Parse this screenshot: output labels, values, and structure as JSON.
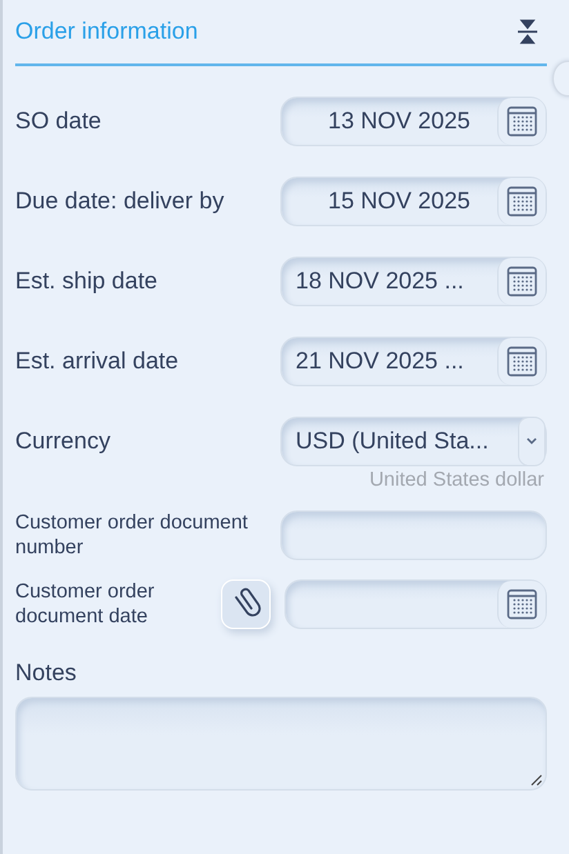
{
  "section": {
    "title": "Order information",
    "rows": [
      {
        "kind": "date",
        "label": "SO date",
        "value": "13 NOV 2025"
      },
      {
        "kind": "date",
        "label": "Due date: deliver by",
        "value": "15 NOV 2025"
      },
      {
        "kind": "date",
        "label": "Est. ship date",
        "value": "18 NOV 2025 ..."
      },
      {
        "kind": "date",
        "label": "Est. arrival date",
        "value": "21 NOV 2025 ..."
      },
      {
        "kind": "select",
        "label": "Currency",
        "value": "USD (United Sta...",
        "note": "United States dollar"
      },
      {
        "kind": "text",
        "label": "Customer order document number"
      },
      {
        "kind": "date-attach",
        "label": "Customer order document date"
      }
    ],
    "notes": {
      "label": "Notes"
    }
  }
}
